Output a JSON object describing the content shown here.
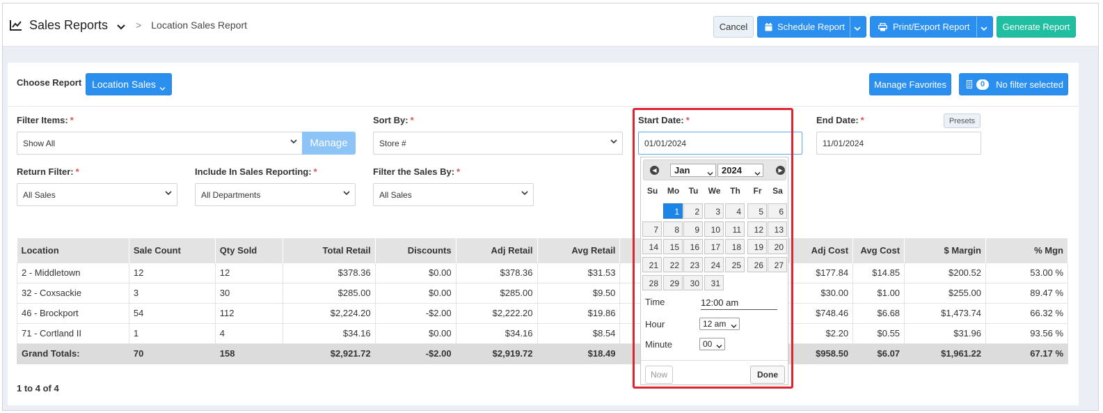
{
  "header": {
    "title": "Sales Reports",
    "breadcrumb_sep": ">",
    "breadcrumb": "Location Sales Report",
    "cancel": "Cancel",
    "schedule": "Schedule Report",
    "print_export": "Print/Export Report",
    "generate": "Generate Report"
  },
  "toolbar": {
    "choose_report_label": "Choose Report",
    "report_type": "Location Sales",
    "manage_favorites": "Manage Favorites",
    "filter_count": "0",
    "filter_status": "No filter selected"
  },
  "filters": {
    "filter_items": {
      "label": "Filter Items:",
      "value": "Show All",
      "manage": "Manage"
    },
    "sort_by": {
      "label": "Sort By:",
      "value": "Store #"
    },
    "start_date": {
      "label": "Start Date:",
      "value": "01/01/2024"
    },
    "end_date": {
      "label": "End Date:",
      "value": "11/01/2024",
      "presets": "Presets"
    },
    "return_filter": {
      "label": "Return Filter:",
      "value": "All Sales"
    },
    "include_in_sales": {
      "label": "Include In Sales Reporting:",
      "value": "All Departments"
    },
    "filter_sales_by": {
      "label": "Filter the Sales By:",
      "value": "All Sales"
    },
    "required_mark": "*"
  },
  "table": {
    "columns": [
      "Location",
      "Sale Count",
      "Qty Sold",
      "Total Retail",
      "Discounts",
      "Adj Retail",
      "Avg Retail",
      "",
      "Adj Cost",
      "Avg Cost",
      "$ Margin",
      "% Mgn"
    ],
    "rows": [
      [
        "2 - Middletown",
        "12",
        "12",
        "$378.36",
        "$0.00",
        "$378.36",
        "$31.53",
        "",
        "$177.84",
        "$14.85",
        "$200.52",
        "53.00 %"
      ],
      [
        "32 - Coxsackie",
        "3",
        "30",
        "$285.00",
        "$0.00",
        "$285.00",
        "$9.50",
        "",
        "$30.00",
        "$1.00",
        "$255.00",
        "89.47 %"
      ],
      [
        "46 - Brockport",
        "54",
        "112",
        "$2,224.20",
        "-$2.00",
        "$2,222.20",
        "$19.86",
        "",
        "$748.46",
        "$6.68",
        "$1,473.74",
        "66.32 %"
      ],
      [
        "71 - Cortland II",
        "1",
        "4",
        "$34.16",
        "$0.00",
        "$34.16",
        "$8.54",
        "",
        "$2.20",
        "$0.55",
        "$31.96",
        "93.56 %"
      ]
    ],
    "totals": [
      "Grand Totals:",
      "70",
      "158",
      "$2,921.72",
      "-$2.00",
      "$2,919.72",
      "$18.49",
      "",
      "$958.50",
      "$6.07",
      "$1,961.22",
      "67.17 %"
    ],
    "pagination": "1 to 4 of 4"
  },
  "datepicker": {
    "month": "Jan",
    "year": "2024",
    "weekdays": [
      "Su",
      "Mo",
      "Tu",
      "We",
      "Th",
      "Fr",
      "Sa"
    ],
    "first_weekday_index": 1,
    "days_in_month": 31,
    "selected_day": 1,
    "time_label": "Time",
    "time_value": "12:00 am",
    "hour_label": "Hour",
    "hour_value": "12 am",
    "minute_label": "Minute",
    "minute_value": "00",
    "now": "Now",
    "done": "Done"
  },
  "colors": {
    "primary": "#2b8ff0",
    "teal": "#21bfa1",
    "highlight": "#e0242f",
    "selected_day": "#1d84e8"
  },
  "icons": [
    "chart-line-icon",
    "chevron-down-icon",
    "calendar-icon",
    "printer-icon",
    "filter-icon",
    "prev-month-icon",
    "next-month-icon"
  ]
}
